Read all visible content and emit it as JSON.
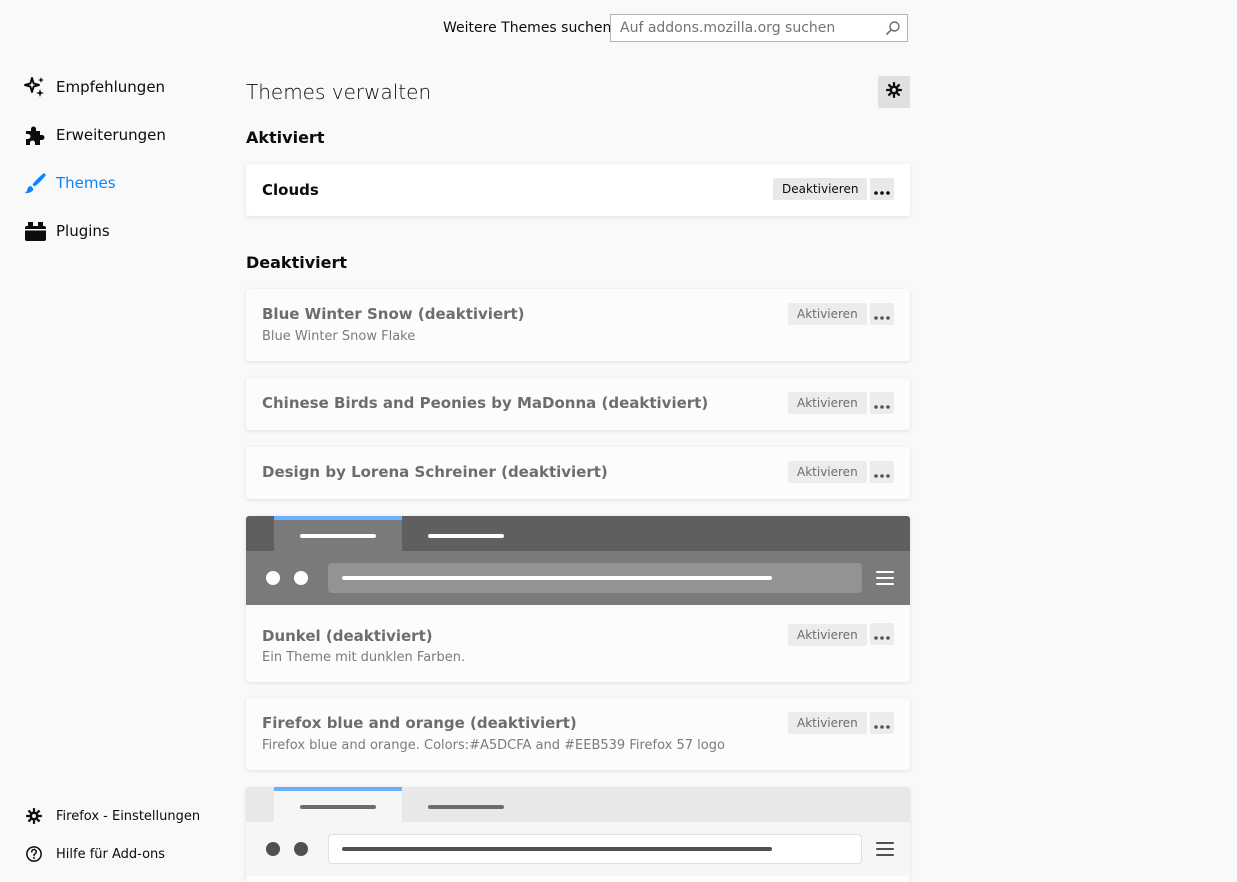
{
  "header": {
    "search_label": "Weitere Themes suchen",
    "search_placeholder": "Auf addons.mozilla.org suchen"
  },
  "sidebar": {
    "items": [
      {
        "label": "Empfehlungen",
        "icon": "sparkle-icon"
      },
      {
        "label": "Erweiterungen",
        "icon": "puzzle-icon"
      },
      {
        "label": "Themes",
        "icon": "brush-icon",
        "selected": true
      },
      {
        "label": "Plugins",
        "icon": "plugin-icon"
      }
    ],
    "footer": [
      {
        "label": "Firefox - Einstellungen",
        "icon": "gear-icon"
      },
      {
        "label": "Hilfe für Add-ons",
        "icon": "help-icon"
      }
    ]
  },
  "main": {
    "title": "Themes verwalten",
    "enabled_heading": "Aktiviert",
    "disabled_heading": "Deaktiviert",
    "enabled": [
      {
        "name": "Clouds",
        "action": "Deaktivieren"
      }
    ],
    "disabled": [
      {
        "name": "Blue Winter Snow (deaktiviert)",
        "description": "Blue Winter Snow Flake",
        "action": "Aktivieren"
      },
      {
        "name": "Chinese Birds and Peonies by MaDonna (deaktiviert)",
        "action": "Aktivieren"
      },
      {
        "name": "Design by Lorena Schreiner (deaktiviert)",
        "action": "Aktivieren"
      },
      {
        "name": "Dunkel (deaktiviert)",
        "description": "Ein Theme mit dunklen Farben.",
        "action": "Aktivieren"
      },
      {
        "name": "Firefox blue and orange (deaktiviert)",
        "description": "Firefox blue and orange. Colors:#A5DCFA and #EEB539 Firefox 57 logo",
        "action": "Aktivieren"
      }
    ]
  },
  "colors": {
    "accent": "#0a84ff",
    "preview_tab_accent": "#6bb0ff"
  }
}
